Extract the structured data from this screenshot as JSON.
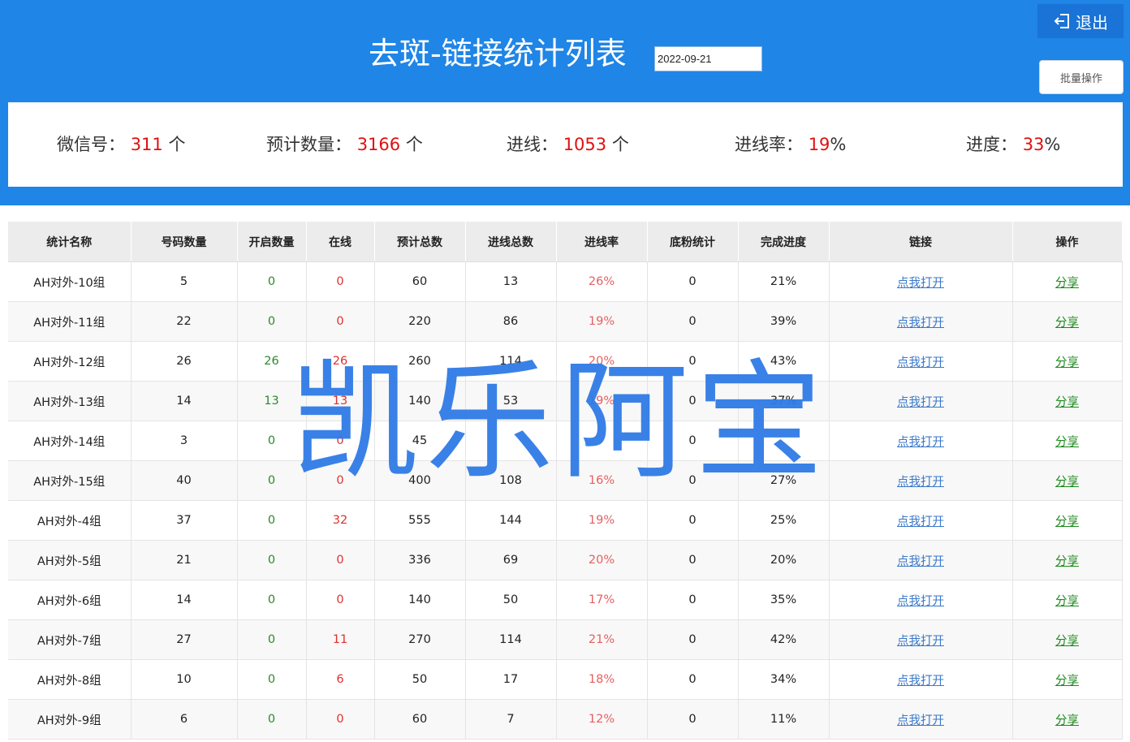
{
  "header": {
    "title": "去斑-链接统计列表",
    "date_value": "2022-09-21",
    "logout_label": "退出",
    "batch_label": "批量操作"
  },
  "stats": {
    "wechat": {
      "label": "微信号：",
      "value": "311",
      "unit": "个"
    },
    "expected": {
      "label": "预计数量：",
      "value": "3166",
      "unit": "个"
    },
    "incoming": {
      "label": "进线：",
      "value": "1053",
      "unit": "个"
    },
    "rate": {
      "label": "进线率：",
      "value": "19",
      "unit": "%"
    },
    "progress": {
      "label": "进度：",
      "value": "33",
      "unit": "%"
    }
  },
  "table": {
    "columns": [
      "统计名称",
      "号码数量",
      "开启数量",
      "在线",
      "预计总数",
      "进线总数",
      "进线率",
      "底粉统计",
      "完成进度",
      "链接",
      "操作"
    ],
    "rows": [
      {
        "name": "AH对外-10组",
        "count": "5",
        "open": "0",
        "online": "0",
        "expected": "60",
        "incoming": "13",
        "rate": "26%",
        "base": "0",
        "progress": "21%",
        "link": "点我打开",
        "action": "分享"
      },
      {
        "name": "AH对外-11组",
        "count": "22",
        "open": "0",
        "online": "0",
        "expected": "220",
        "incoming": "86",
        "rate": "19%",
        "base": "0",
        "progress": "39%",
        "link": "点我打开",
        "action": "分享"
      },
      {
        "name": "AH对外-12组",
        "count": "26",
        "open": "26",
        "online": "26",
        "expected": "260",
        "incoming": "114",
        "rate": "20%",
        "base": "0",
        "progress": "43%",
        "link": "点我打开",
        "action": "分享"
      },
      {
        "name": "AH对外-13组",
        "count": "14",
        "open": "13",
        "online": "13",
        "expected": "140",
        "incoming": "53",
        "rate": "19%",
        "base": "0",
        "progress": "37%",
        "link": "点我打开",
        "action": "分享"
      },
      {
        "name": "AH对外-14组",
        "count": "3",
        "open": "0",
        "online": "0",
        "expected": "45",
        "incoming": "",
        "rate": "",
        "base": "0",
        "progress": "",
        "link": "点我打开",
        "action": "分享"
      },
      {
        "name": "AH对外-15组",
        "count": "40",
        "open": "0",
        "online": "0",
        "expected": "400",
        "incoming": "108",
        "rate": "16%",
        "base": "0",
        "progress": "27%",
        "link": "点我打开",
        "action": "分享"
      },
      {
        "name": "AH对外-4组",
        "count": "37",
        "open": "0",
        "online": "32",
        "expected": "555",
        "incoming": "144",
        "rate": "19%",
        "base": "0",
        "progress": "25%",
        "link": "点我打开",
        "action": "分享"
      },
      {
        "name": "AH对外-5组",
        "count": "21",
        "open": "0",
        "online": "0",
        "expected": "336",
        "incoming": "69",
        "rate": "20%",
        "base": "0",
        "progress": "20%",
        "link": "点我打开",
        "action": "分享"
      },
      {
        "name": "AH对外-6组",
        "count": "14",
        "open": "0",
        "online": "0",
        "expected": "140",
        "incoming": "50",
        "rate": "17%",
        "base": "0",
        "progress": "35%",
        "link": "点我打开",
        "action": "分享"
      },
      {
        "name": "AH对外-7组",
        "count": "27",
        "open": "0",
        "online": "11",
        "expected": "270",
        "incoming": "114",
        "rate": "21%",
        "base": "0",
        "progress": "42%",
        "link": "点我打开",
        "action": "分享"
      },
      {
        "name": "AH对外-8组",
        "count": "10",
        "open": "0",
        "online": "6",
        "expected": "50",
        "incoming": "17",
        "rate": "18%",
        "base": "0",
        "progress": "34%",
        "link": "点我打开",
        "action": "分享"
      },
      {
        "name": "AH对外-9组",
        "count": "6",
        "open": "0",
        "online": "0",
        "expected": "60",
        "incoming": "7",
        "rate": "12%",
        "base": "0",
        "progress": "11%",
        "link": "点我打开",
        "action": "分享"
      }
    ]
  },
  "watermark": "凯乐阿宝",
  "colors": {
    "header_bg": "#1f85e6",
    "highlight": "#e01010",
    "open_green": "#2a8a2a",
    "online_red": "#e03030"
  },
  "icons": {
    "logout": "logout-icon"
  }
}
